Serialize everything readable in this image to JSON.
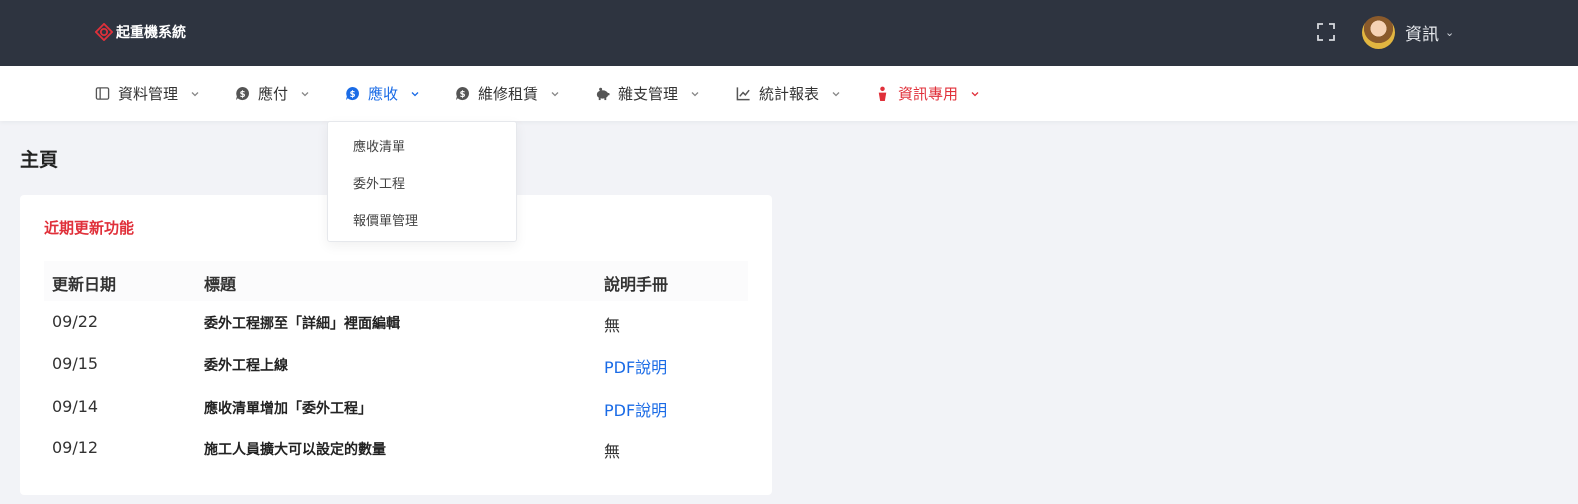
{
  "app": {
    "logo_text": "起重機系統"
  },
  "header": {
    "user_name": "資訊"
  },
  "nav": [
    {
      "label": "資料管理"
    },
    {
      "label": "應付"
    },
    {
      "label": "應收"
    },
    {
      "label": "維修租賃"
    },
    {
      "label": "雜支管理"
    },
    {
      "label": "統計報表"
    },
    {
      "label": "資訊專用"
    }
  ],
  "dropdown": {
    "items": [
      "應收清單",
      "委外工程",
      "報價單管理"
    ]
  },
  "page": {
    "title": "主頁"
  },
  "card": {
    "title": "近期更新功能",
    "columns": [
      "更新日期",
      "標題",
      "說明手冊"
    ],
    "rows": [
      {
        "date": "09/22",
        "title": "委外工程挪至「詳細」裡面編輯",
        "manual": "無"
      },
      {
        "date": "09/15",
        "title": "委外工程上線",
        "manual": "PDF說明"
      },
      {
        "date": "09/14",
        "title": "應收清單增加「委外工程」",
        "manual": "PDF說明"
      },
      {
        "date": "09/12",
        "title": "施工人員擴大可以設定的數量",
        "manual": "無"
      }
    ]
  },
  "colors": {
    "topbar": "#2e3440",
    "accent_blue": "#1a6be6",
    "accent_red": "#e0303a"
  }
}
